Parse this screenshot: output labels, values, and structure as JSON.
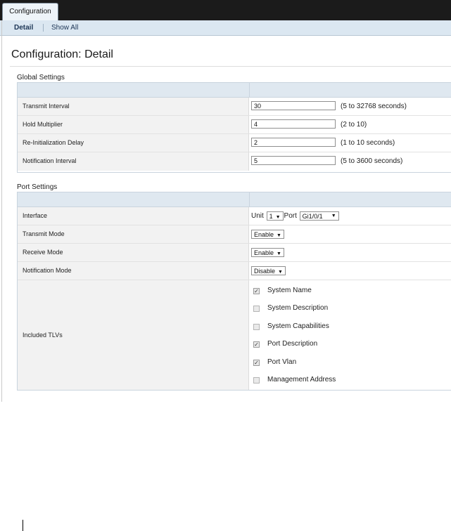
{
  "tabs": [
    {
      "label": "Configuration",
      "active": true
    }
  ],
  "subnav": {
    "detail": "Detail",
    "show_all": "Show All"
  },
  "page_title": "Configuration: Detail",
  "global_settings": {
    "title": "Global Settings",
    "rows": [
      {
        "label": "Transmit Interval",
        "value": "30",
        "hint": "(5 to 32768 seconds)"
      },
      {
        "label": "Hold Multiplier",
        "value": "4",
        "hint": "(2 to 10)"
      },
      {
        "label": "Re-Initialization Delay",
        "value": "2",
        "hint": "(1 to 10 seconds)"
      },
      {
        "label": "Notification Interval",
        "value": "5",
        "hint": "(5 to 3600 seconds)"
      }
    ]
  },
  "port_settings": {
    "title": "Port Settings",
    "interface": {
      "label": "Interface",
      "unit_label": "Unit",
      "unit_value": "1",
      "port_label": "Port",
      "port_value": "Gi1/0/1"
    },
    "transmit_mode": {
      "label": "Transmit Mode",
      "value": "Enable"
    },
    "receive_mode": {
      "label": "Receive Mode",
      "value": "Enable"
    },
    "notification_mode": {
      "label": "Notification Mode",
      "value": "Disable"
    },
    "included_tlvs": {
      "label": "Included TLVs",
      "items": [
        {
          "label": "System Name",
          "checked": true
        },
        {
          "label": "System Description",
          "checked": false
        },
        {
          "label": "System Capabilities",
          "checked": false
        },
        {
          "label": "Port Description",
          "checked": true
        },
        {
          "label": "Port Vlan",
          "checked": true
        },
        {
          "label": "Management Address",
          "checked": false
        }
      ]
    }
  },
  "icons": {
    "dropdown": "chevron-down-icon",
    "checkbox_checked": "checkmark-icon"
  }
}
